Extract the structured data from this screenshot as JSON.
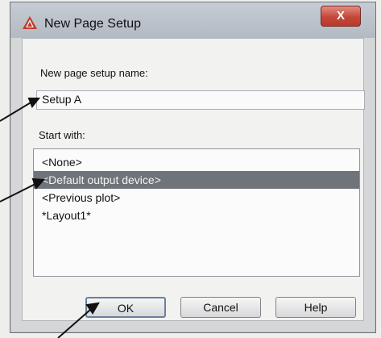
{
  "dialog": {
    "title": "New Page Setup",
    "close_label": "X",
    "name_label": "New page setup name:",
    "name_value": "Setup A",
    "start_with_label": "Start with:",
    "list_items": [
      {
        "label": "<None>",
        "selected": false
      },
      {
        "label": "<Default output device>",
        "selected": true
      },
      {
        "label": "<Previous plot>",
        "selected": false
      },
      {
        "label": "*Layout1*",
        "selected": false
      }
    ],
    "buttons": {
      "ok": "OK",
      "cancel": "Cancel",
      "help": "Help"
    }
  }
}
